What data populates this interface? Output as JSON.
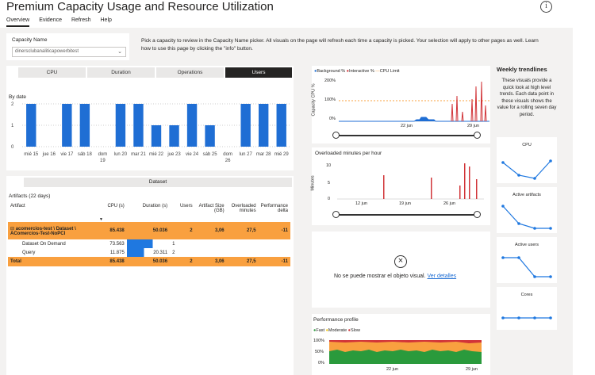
{
  "header": {
    "title": "Premium Capacity Usage and Resource Utilization",
    "info_icon": "i"
  },
  "tabs": [
    {
      "label": "Overview"
    },
    {
      "label": "Evidence"
    },
    {
      "label": "Refresh"
    },
    {
      "label": "Help"
    }
  ],
  "capacity": {
    "label": "Capacity Name",
    "value": "dinersclubanaliticapowerbitest"
  },
  "intro_text": "Pick a capacity to review in the Capacity Name picker. All visuals on the page will refresh each time a capacity is picked. Your selection will apply to other pages as well. Learn how to use this page by clicking the \"info\" button.",
  "segments": [
    "CPU",
    "Duration",
    "Operations",
    "Users"
  ],
  "by_date": {
    "label": "By date"
  },
  "chart_data": [
    {
      "type": "bar",
      "title": "By date",
      "categories": [
        "mié 15",
        "jue 16",
        "vie 17",
        "sáb 18",
        "dom 19",
        "lun 20",
        "mar 21",
        "mié 22",
        "jue 23",
        "vie 24",
        "sáb 25",
        "dom 26",
        "lun 27",
        "mar 28",
        "mié 29"
      ],
      "values": [
        2,
        0,
        2,
        2,
        0,
        2,
        2,
        1,
        1,
        2,
        1,
        0,
        2,
        2,
        2
      ],
      "yticks": [
        "0",
        "1",
        "2"
      ],
      "ylim": [
        0,
        2.2
      ]
    },
    {
      "type": "line",
      "legend": [
        "Background %",
        "Interactive %",
        "CPU Limit"
      ],
      "ylabel": "Capacity CPU %",
      "yticks": [
        "0%",
        "100%",
        "200%"
      ],
      "xticks": [
        "22 jun",
        "29 jun"
      ]
    },
    {
      "type": "bar",
      "title": "Overloaded minutes per hour",
      "ylabel": "Minutes",
      "yticks": [
        "0",
        "5",
        "10"
      ],
      "xticks": [
        "12 jun",
        "19 jun",
        "26 jun"
      ]
    },
    {
      "type": "area",
      "title": "Performance profile",
      "legend": [
        "Fast",
        "Moderate",
        "Slow"
      ],
      "yticks": [
        "0%",
        "50%",
        "100%"
      ],
      "xticks": [
        "22 jun",
        "29 jun"
      ]
    }
  ],
  "dataset_header": "Dataset",
  "artifacts": {
    "title": "Artifacts (22 days)",
    "columns": [
      "Artifact",
      "CPU (s)",
      "Duration (s)",
      "Users",
      "Artifact Size (GB)",
      "Overloaded minutes",
      "Performance delta"
    ],
    "rows": [
      {
        "name": "acomercios-test \\ Dataset \\ AComercios-Test-NoPCI",
        "cpu": "85.438",
        "dur": "50.036",
        "users": "2",
        "size": "3,06",
        "over": "27,5",
        "perf": "-11"
      },
      {
        "name": "Dataset On Demand",
        "cpu": "73.563",
        "dur": "29.724",
        "users": "1",
        "size": "",
        "over": "",
        "perf": ""
      },
      {
        "name": "Query",
        "cpu": "11.875",
        "dur": "20.311",
        "users": "2",
        "size": "",
        "over": "",
        "perf": ""
      }
    ],
    "total": {
      "name": "Total",
      "cpu": "85.438",
      "dur": "50.036",
      "users": "2",
      "size": "3,06",
      "over": "27,5",
      "perf": "-11"
    }
  },
  "legend_cpu": {
    "bg": "Background %",
    "int": "Interactive %",
    "lim": "CPU Limit",
    "ylabel": "Capacity CPU %",
    "y0": "0%",
    "y1": "100%",
    "y2": "200%",
    "x1": "22 jun",
    "x2": "29 jun"
  },
  "overload": {
    "title": "Overloaded minutes per hour",
    "ylabel": "Minutes",
    "y0": "0",
    "y1": "5",
    "y2": "10",
    "x1": "12 jun",
    "x2": "19 jun",
    "x3": "26 jun"
  },
  "error": {
    "msg": "No se puede mostrar el objeto visual.",
    "link": "Ver detalles"
  },
  "perf": {
    "title": "Performance profile",
    "fast": "Fast",
    "mod": "Moderate",
    "slow": "Slow",
    "y0": "0%",
    "y1": "50%",
    "y2": "100%",
    "x1": "22 jun",
    "x2": "29 jun"
  },
  "trendlines": {
    "title": "Weekly trendlines",
    "desc": "These visuals provide a quick look at high level trends. Each data point in these visuals shows the value for a rolling seven day period.",
    "cards": [
      {
        "label": "CPU"
      },
      {
        "label": "Active artifacts"
      },
      {
        "label": "Active users"
      },
      {
        "label": "Cores"
      }
    ]
  },
  "colors": {
    "blue": "#1f6ed4",
    "red": "#d13438",
    "orange": "#f9a03f",
    "green": "#2a9a3c",
    "yellow": "#f2c811"
  }
}
